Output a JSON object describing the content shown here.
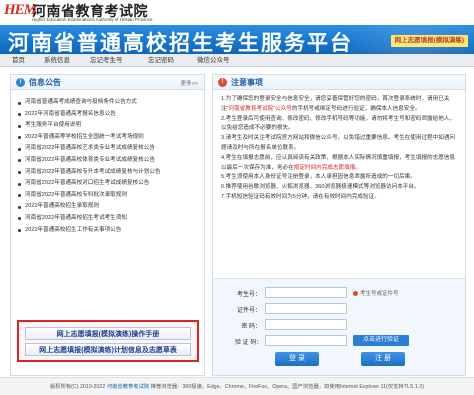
{
  "brand": {
    "logo_text": "HEM",
    "institution_name": "河南省教育考试院",
    "institution_english": "Higher Education Examinations Authority of HeNan Province"
  },
  "banner": {
    "title": "河南省普通高校招生考生服务平台",
    "link_label": "网上志愿填报(模拟演练)"
  },
  "nav": {
    "items": [
      "首页",
      "系统信息",
      "忘记考生号",
      "忘记密码",
      "微信公众号"
    ]
  },
  "news": {
    "title": "信息公告",
    "more_label": "更多>>",
    "items": [
      "河南省普通高考成绩查询与投档条件公告方式",
      "2022年河南省普通高考报名信息公告",
      "考生服务平台使用说明",
      "2022年普通高等学校招生全国统一考试考场规则",
      "河南省2022年普通高校艺术类专业考试成绩复核公告",
      "河南省2022年普通高校体育类专业考试成绩复核公告",
      "河南省2022年普通高校专升本考试成绩复核与计划公告",
      "河南省2022年普通高校对口招生考试成绩复核公告",
      "河南省2022年普通高校专科批次录取规则",
      "2022年普通高校招生录取规则",
      "河南省2022年普通高校招生考试考生须知",
      "2022年普通高校招生工作有关事项公告"
    ]
  },
  "promo": {
    "button1": "网上志愿填报(模拟演练)操作手册",
    "button2": "网上志愿填报(模拟演练)计划信息及志愿草表"
  },
  "notes": {
    "title": "注意事项",
    "paragraphs": [
      {
        "text": "1.为了确保您的登录安全与信息安全，请您妥善保管好您的密码，首次登录系统时，请用已关注“河南省教育考试院”公众号的手机号或绑定号码进行验证，确保本人信息安全。",
        "highlight": "“河南省教育考试院”公众号"
      },
      {
        "text": "2.考生登录后可使用查询、修改密码、修改手机号码等功能，请勿将考生号和密码泄露给他人，以免给您造成不必要的损失。",
        "highlight": ""
      },
      {
        "text": "3.请考生及时关注考试院官方网站和微信公众号，以免错过重要信息。考生在使用过程中如遇问题请及时与所在报名单位联系。",
        "highlight": ""
      },
      {
        "text": "4.考生在填报志愿前，应认真阅读有关政策，根据本人实际情况慎重填报，考生填报的志愿信息以最后一次保存为准，务必在规定时间内完成志愿填报。",
        "highlight": "规定时间内完成志愿填报"
      },
      {
        "text": "5.考生须使用本人身份证号注册登录，本人承担因信息泄露所造成的一切后果。",
        "highlight": ""
      },
      {
        "text": "6.推荐使用谷歌浏览器、火狐浏览器、360浏览器极速模式等浏览器访问本平台。",
        "highlight": ""
      },
      {
        "text": "7.手机短信验证码有效时间为5分钟，请在有效时间内完成验证。",
        "highlight": ""
      }
    ]
  },
  "login_form": {
    "student_id_label": "考生号：",
    "student_id_placeholder": "",
    "student_id_hint": "考生号或证件号",
    "id_card_label": "证件号：",
    "id_card_placeholder": "",
    "password_label": "密  码：",
    "password_placeholder": "",
    "captcha_label": "验 证 码：",
    "captcha_button": "点击进行验证",
    "login_button": "登 录",
    "register_button": "注 册"
  },
  "footer": {
    "copyright": "版权所有(C) 2010-2022",
    "org_link": "河南省教育考试院",
    "browsers": "推荐浏览器：360极速、Edge、Chrome、FireFox、Opera、国产浏览器，如使用Internet Explorer 11(仅支持TLS 1.2)"
  },
  "colors": {
    "banner": "#1677cf",
    "accent_red": "#d8252a",
    "link_blue": "#1b5fa8",
    "banner_link_bg": "#ffe45c"
  }
}
